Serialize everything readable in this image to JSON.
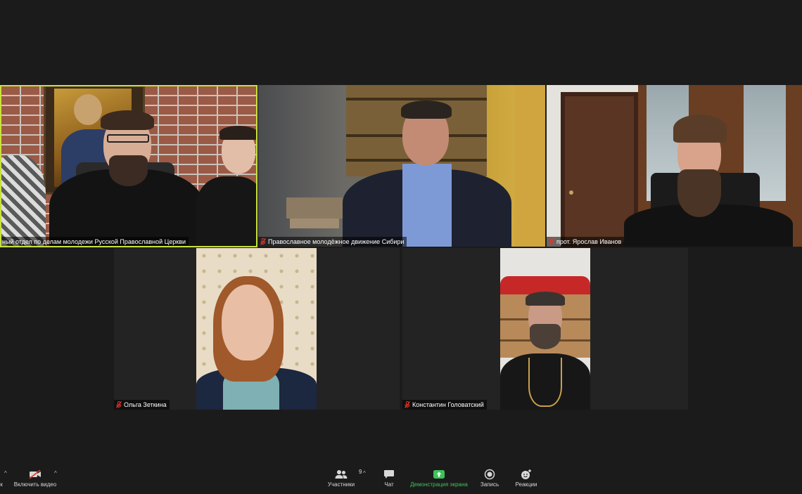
{
  "participants": [
    {
      "name": "ный отдел по делам молодежи Русской Православной Церкви",
      "muted": false,
      "active_speaker": true
    },
    {
      "name": "Православное молодёжное движение Сибири",
      "muted": true,
      "active_speaker": false
    },
    {
      "name": "прот. Ярослав Иванов",
      "muted": true,
      "active_speaker": false
    },
    {
      "name": "Ольга Зеткина",
      "muted": true,
      "active_speaker": false
    },
    {
      "name": "Константин Головатский",
      "muted": true,
      "active_speaker": false
    }
  ],
  "toolbar": {
    "left": {
      "mic_label": "к",
      "video_label": "Включить видео"
    },
    "participants_label": "Участники",
    "participants_count": "9",
    "chat_label": "Чат",
    "share_label": "Демонстрация экрана",
    "record_label": "Запись",
    "reactions_label": "Реакции"
  },
  "colors": {
    "background": "#1b1b1b",
    "tile": "#232323",
    "active_speaker_border": "#c9e13a",
    "share_green": "#3ec25a",
    "muted_red": "#e0362c"
  },
  "icons": {
    "mic": "mic-icon",
    "video": "video-off-icon",
    "participants": "participants-icon",
    "chat": "chat-icon",
    "share": "share-screen-icon",
    "record": "record-icon",
    "reactions": "reactions-icon",
    "muted": "mic-muted-icon"
  }
}
